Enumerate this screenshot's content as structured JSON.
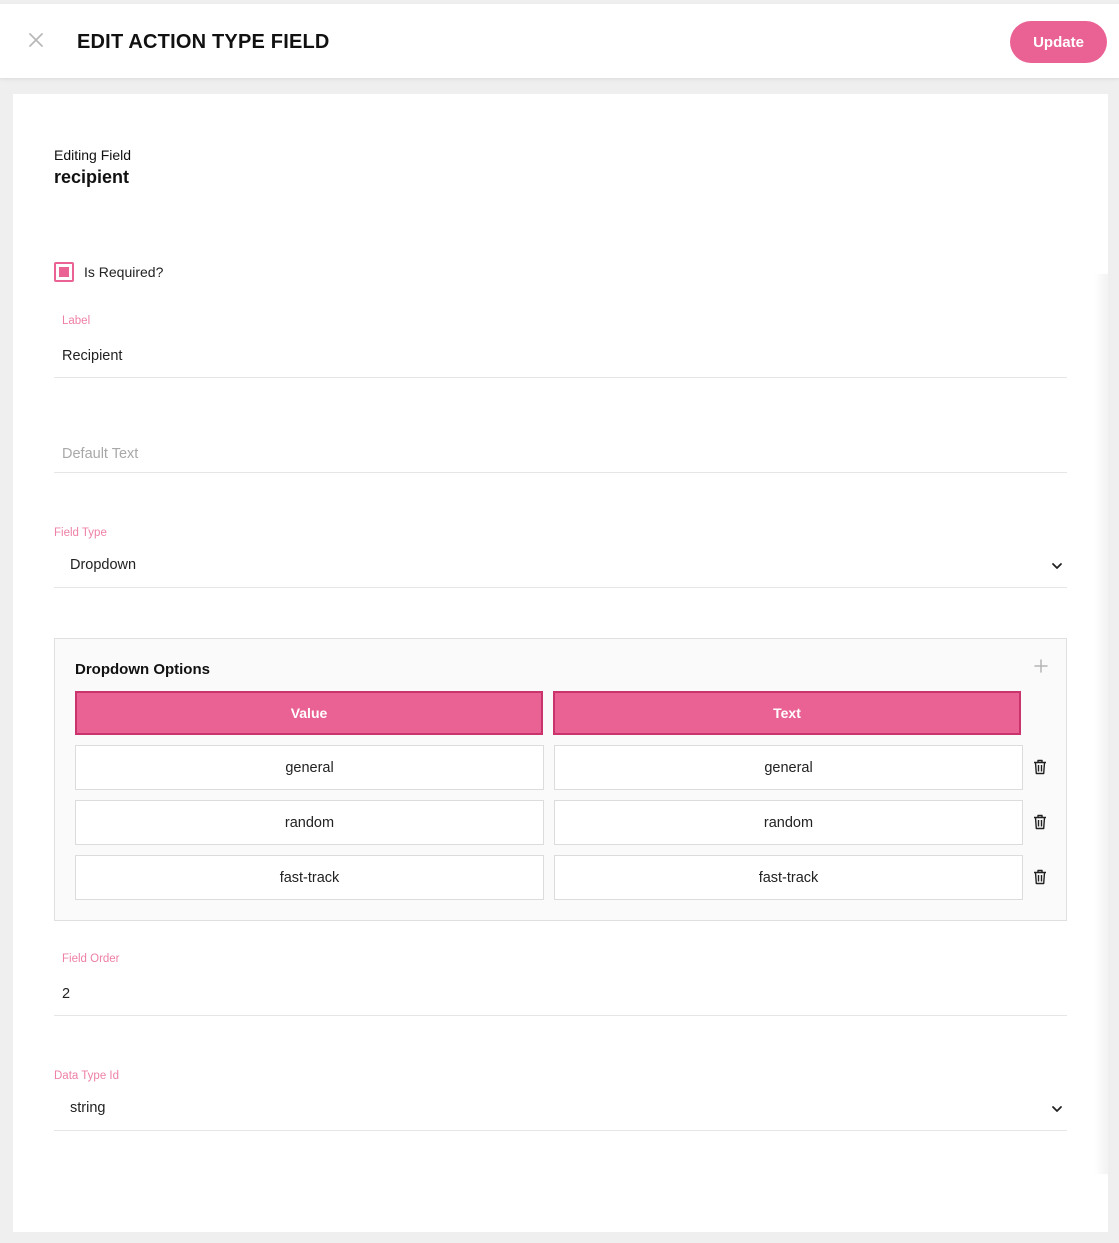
{
  "header": {
    "title": "EDIT ACTION TYPE FIELD",
    "close_icon": "close-icon",
    "update_label": "Update",
    "accent_color": "#ea6294"
  },
  "editing": {
    "caption": "Editing Field",
    "field_name": "recipient"
  },
  "required": {
    "label": "Is Required?",
    "checked": true
  },
  "label_field": {
    "label": "Label",
    "value": "Recipient"
  },
  "default_text_field": {
    "placeholder": "Default Text",
    "value": ""
  },
  "field_type": {
    "label": "Field Type",
    "selected": "Dropdown"
  },
  "dropdown_options": {
    "title": "Dropdown Options",
    "add_icon": "plus-icon",
    "delete_icon": "trash-icon",
    "columns": [
      "Value",
      "Text"
    ],
    "rows": [
      {
        "value": "general",
        "text": "general"
      },
      {
        "value": "random",
        "text": "random"
      },
      {
        "value": "fast-track",
        "text": "fast-track"
      }
    ]
  },
  "field_order": {
    "label": "Field Order",
    "value": "2"
  },
  "data_type": {
    "label": "Data Type Id",
    "selected": "string"
  }
}
